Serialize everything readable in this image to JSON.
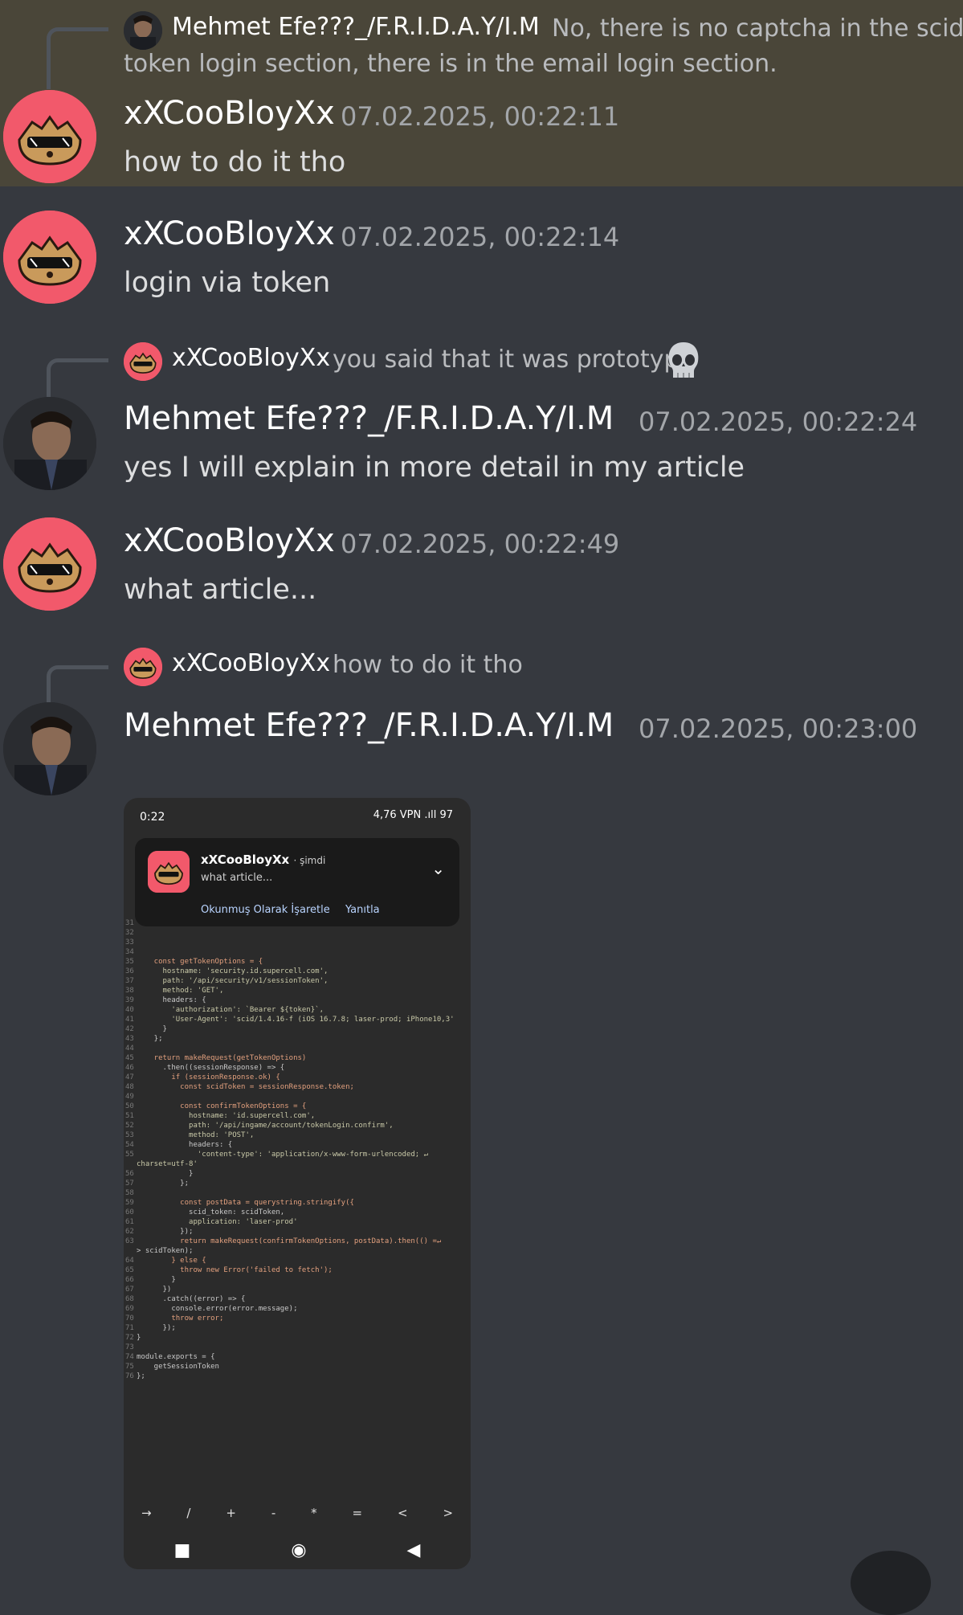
{
  "messages": [
    {
      "reply": {
        "name": "Mehmet Efe???_/F.R.I.D.A.Y/I.M",
        "text_line1": "No, there is no captcha in the scid",
        "text_line2": "token login section, there is in the email login section."
      },
      "author": "xXCooBloyXx",
      "time": "07.02.2025, 00:22:11",
      "text": "how to do it tho"
    },
    {
      "author": "xXCooBloyXx",
      "time": "07.02.2025, 00:22:14",
      "text": "login via token"
    },
    {
      "reply": {
        "name": "xXCooBloyXx",
        "text": "you said that it was prototype"
      },
      "author": "Mehmet Efe???_/F.R.I.D.A.Y/I.M",
      "time": "07.02.2025, 00:22:24",
      "text": "yes I will explain in more detail in my article"
    },
    {
      "author": "xXCooBloyXx",
      "time": "07.02.2025, 00:22:49",
      "text": "what article..."
    },
    {
      "reply": {
        "name": "xXCooBloyXx",
        "text": "how to do it tho"
      },
      "author": "Mehmet Efe???_/F.R.I.D.A.Y/I.M",
      "time": "07.02.2025, 00:23:00"
    }
  ],
  "attachment": {
    "status_time": "0:22",
    "status_right": "4,76 VPN .ıll 97",
    "notification": {
      "name": "xXCooBloyXx",
      "when": "· şimdi",
      "message": "what article...",
      "action_mark_read": "Okunmuş Olarak İşaretle",
      "action_reply": "Yanıtla"
    },
    "code_lines": [
      {
        "n": "31",
        "t": ""
      },
      {
        "n": "32",
        "t": ""
      },
      {
        "n": "33",
        "t": ""
      },
      {
        "n": "34",
        "t": ""
      },
      {
        "n": "35",
        "t": "    const getTokenOptions = {"
      },
      {
        "n": "36",
        "t": "      hostname: 'security.id.supercell.com',"
      },
      {
        "n": "37",
        "t": "      path: '/api/security/v1/sessionToken',"
      },
      {
        "n": "38",
        "t": "      method: 'GET',"
      },
      {
        "n": "39",
        "t": "      headers: {"
      },
      {
        "n": "40",
        "t": "        'authorization': `Bearer ${token}`,"
      },
      {
        "n": "41",
        "t": "        'User-Agent': 'scid/1.4.16-f (iOS 16.7.8; laser-prod; iPhone10,3'"
      },
      {
        "n": "42",
        "t": "      }"
      },
      {
        "n": "43",
        "t": "    };"
      },
      {
        "n": "44",
        "t": ""
      },
      {
        "n": "45",
        "t": "    return makeRequest(getTokenOptions)"
      },
      {
        "n": "46",
        "t": "      .then((sessionResponse) => {"
      },
      {
        "n": "47",
        "t": "        if (sessionResponse.ok) {"
      },
      {
        "n": "48",
        "t": "          const scidToken = sessionResponse.token;"
      },
      {
        "n": "49",
        "t": ""
      },
      {
        "n": "50",
        "t": "          const confirmTokenOptions = {"
      },
      {
        "n": "51",
        "t": "            hostname: 'id.supercell.com',"
      },
      {
        "n": "52",
        "t": "            path: '/api/ingame/account/tokenLogin.confirm',"
      },
      {
        "n": "53",
        "t": "            method: 'POST',"
      },
      {
        "n": "54",
        "t": "            headers: {"
      },
      {
        "n": "55",
        "t": "              'content-type': 'application/x-www-form-urlencoded; ↵"
      },
      {
        "n": "",
        "t": "charset=utf-8'"
      },
      {
        "n": "56",
        "t": "            }"
      },
      {
        "n": "57",
        "t": "          };"
      },
      {
        "n": "58",
        "t": ""
      },
      {
        "n": "59",
        "t": "          const postData = querystring.stringify({"
      },
      {
        "n": "60",
        "t": "            scid_token: scidToken,"
      },
      {
        "n": "61",
        "t": "            application: 'laser-prod'"
      },
      {
        "n": "62",
        "t": "          });"
      },
      {
        "n": "63",
        "t": "          return makeRequest(confirmTokenOptions, postData).then(() =↵"
      },
      {
        "n": "",
        "t": "> scidToken);"
      },
      {
        "n": "64",
        "t": "        } else {"
      },
      {
        "n": "65",
        "t": "          throw new Error('failed to fetch');"
      },
      {
        "n": "66",
        "t": "        }"
      },
      {
        "n": "67",
        "t": "      })"
      },
      {
        "n": "68",
        "t": "      .catch((error) => {"
      },
      {
        "n": "69",
        "t": "        console.error(error.message);"
      },
      {
        "n": "70",
        "t": "        throw error;"
      },
      {
        "n": "71",
        "t": "      });"
      },
      {
        "n": "72",
        "t": "}"
      },
      {
        "n": "73",
        "t": ""
      },
      {
        "n": "74",
        "t": "module.exports = {"
      },
      {
        "n": "75",
        "t": "    getSessionToken"
      },
      {
        "n": "76",
        "t": "};"
      }
    ],
    "keys": [
      "→",
      "/",
      "+",
      "-",
      "*",
      "=",
      "<",
      ">"
    ],
    "nav": [
      "■",
      "◉",
      "◀"
    ]
  }
}
